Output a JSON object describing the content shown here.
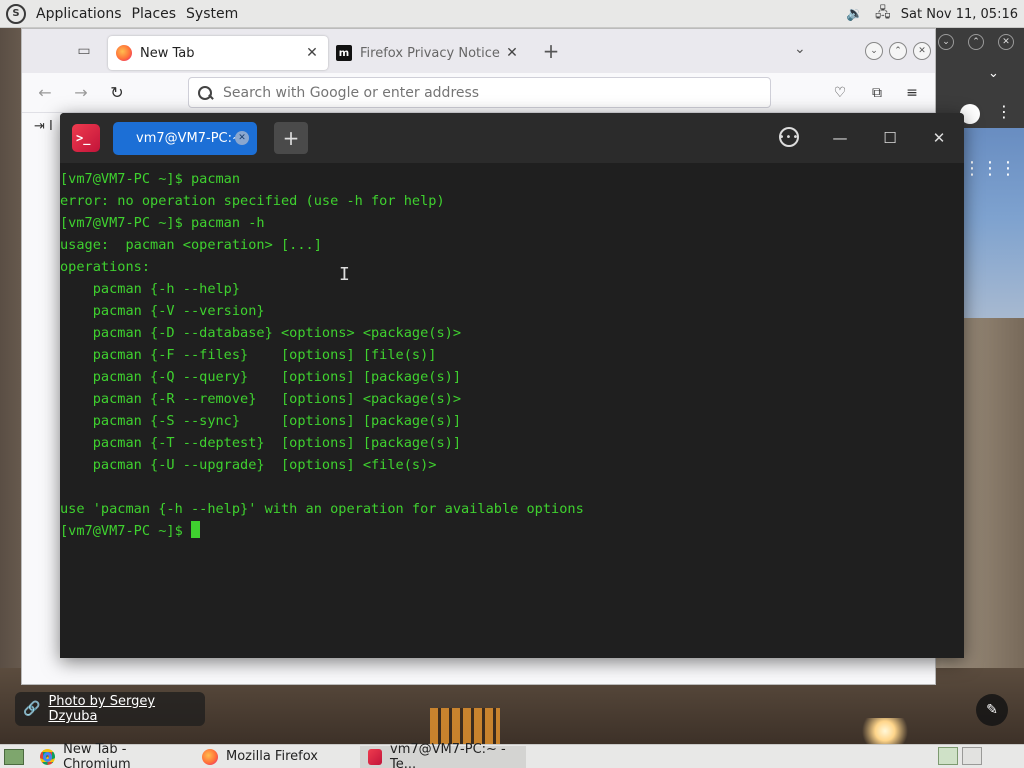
{
  "top_panel": {
    "menus": [
      "Applications",
      "Places",
      "System"
    ],
    "clock": "Sat Nov 11, 05:16"
  },
  "firefox": {
    "tabs": [
      {
        "label": "New Tab",
        "active": true
      },
      {
        "label": "Firefox Privacy Notice — M",
        "active": false
      }
    ],
    "urlbar_placeholder": "Search with Google or enter address",
    "import_label": "I"
  },
  "terminal": {
    "tab_label": "vm7@VM7-PC:~",
    "lines": [
      "[vm7@VM7-PC ~]$ pacman",
      "error: no operation specified (use -h for help)",
      "[vm7@VM7-PC ~]$ pacman -h",
      "usage:  pacman <operation> [...]",
      "operations:",
      "    pacman {-h --help}",
      "    pacman {-V --version}",
      "    pacman {-D --database} <options> <package(s)>",
      "    pacman {-F --files}    [options] [file(s)]",
      "    pacman {-Q --query}    [options] [package(s)]",
      "    pacman {-R --remove}   [options] <package(s)>",
      "    pacman {-S --sync}     [options] [package(s)]",
      "    pacman {-T --deptest}  [options] [package(s)]",
      "    pacman {-U --upgrade}  [options] <file(s)>",
      "",
      "use 'pacman {-h --help}' with an operation for available options"
    ],
    "prompt": "[vm7@VM7-PC ~]$ ",
    "text_color": "#3fd12f",
    "background": "#1f1f1f"
  },
  "desktop": {
    "photo_credit": "Photo by Sergey Dzyuba"
  },
  "taskbar": {
    "items": [
      {
        "label": "New Tab - Chromium",
        "icon": "chromium-icon"
      },
      {
        "label": "Mozilla Firefox",
        "icon": "firefox-icon"
      },
      {
        "label": "vm7@VM7-PC:~ - Te...",
        "icon": "terminal-icon",
        "active": true
      }
    ]
  }
}
